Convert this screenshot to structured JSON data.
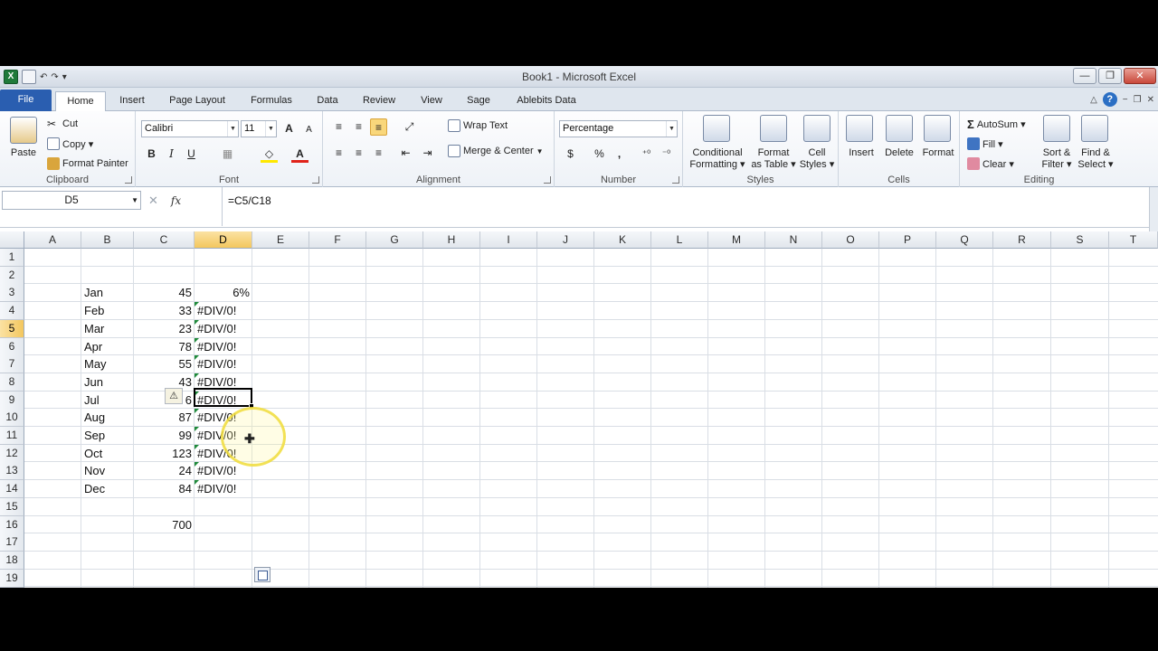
{
  "window": {
    "title": "Book1 - Microsoft Excel",
    "minimize": "—",
    "restore": "❐",
    "close": "✕"
  },
  "qat": {
    "app_letter": "X",
    "sep": "|",
    "undo": "↶",
    "redo": "↷",
    "more": "▾"
  },
  "tabs": [
    "File",
    "Home",
    "Insert",
    "Page Layout",
    "Formulas",
    "Data",
    "Review",
    "View",
    "Sage",
    "Ablebits Data"
  ],
  "tabs_right": {
    "ribbon_toggle": "△",
    "help": "?",
    "minimize": "−",
    "restore": "❐",
    "close": "✕"
  },
  "ribbon": {
    "clipboard": {
      "paste": "Paste",
      "cut": "Cut",
      "copy": "Copy ▾",
      "format_painter": "Format Painter",
      "label": "Clipboard"
    },
    "font": {
      "name": "Calibri",
      "size": "11",
      "grow": "A",
      "shrink": "A",
      "bold": "B",
      "italic": "I",
      "underline": "U",
      "border": "▦",
      "fill": "◇",
      "color": "A",
      "label": "Font"
    },
    "alignment": {
      "wrap": "Wrap Text",
      "merge": "Merge & Center",
      "label": "Alignment"
    },
    "number": {
      "format": "Percentage",
      "currency": "$",
      "percent": "%",
      "comma": ",",
      "inc_dec": "⁺⁰",
      "dec_dec": "⁻⁰",
      "label": "Number"
    },
    "styles": {
      "conditional": [
        "Conditional",
        "Formatting ▾"
      ],
      "as_table": [
        "Format",
        "as Table ▾"
      ],
      "cell_styles": [
        "Cell",
        "Styles ▾"
      ],
      "label": "Styles"
    },
    "cells": {
      "insert": "Insert",
      "delete": "Delete",
      "format": "Format",
      "label": "Cells"
    },
    "editing": {
      "autosum": "AutoSum ▾",
      "sigma": "Σ",
      "fill": "Fill ▾",
      "clear": "Clear ▾",
      "sort": [
        "Sort &",
        "Filter ▾"
      ],
      "find": [
        "Find &",
        "Select ▾"
      ],
      "label": "Editing"
    }
  },
  "formula_bar": {
    "name_box": "D5",
    "cancel": "✕",
    "fx": "fx",
    "formula": "=C5/C18"
  },
  "columns": [
    "A",
    "B",
    "C",
    "D",
    "E",
    "F",
    "G",
    "H",
    "I",
    "J",
    "K",
    "L",
    "M",
    "N",
    "O",
    "P",
    "Q",
    "R",
    "S",
    "T"
  ],
  "rows": [
    "1",
    "2",
    "3",
    "4",
    "5",
    "6",
    "7",
    "8",
    "9",
    "10",
    "11",
    "12",
    "13",
    "14",
    "15",
    "16",
    "17",
    "18",
    "19"
  ],
  "selected_cell": "D5",
  "cells": {
    "months": [
      "Jan",
      "Feb",
      "Mar",
      "Apr",
      "May",
      "Jun",
      "Jul",
      "Aug",
      "Sep",
      "Oct",
      "Nov",
      "Dec"
    ],
    "values": [
      "45",
      "33",
      "23",
      "78",
      "55",
      "43",
      "6",
      "87",
      "99",
      "123",
      "24",
      "84"
    ],
    "results": [
      "6%",
      "#DIV/0!",
      "#DIV/0!",
      "#DIV/0!",
      "#DIV/0!",
      "#DIV/0!",
      "#DIV/0!",
      "#DIV/0!",
      "#DIV/0!",
      "#DIV/0!",
      "#DIV/0!",
      "#DIV/0!"
    ],
    "total": "700"
  },
  "warning_glyph": "⚠",
  "cursor_glyph": "✚"
}
